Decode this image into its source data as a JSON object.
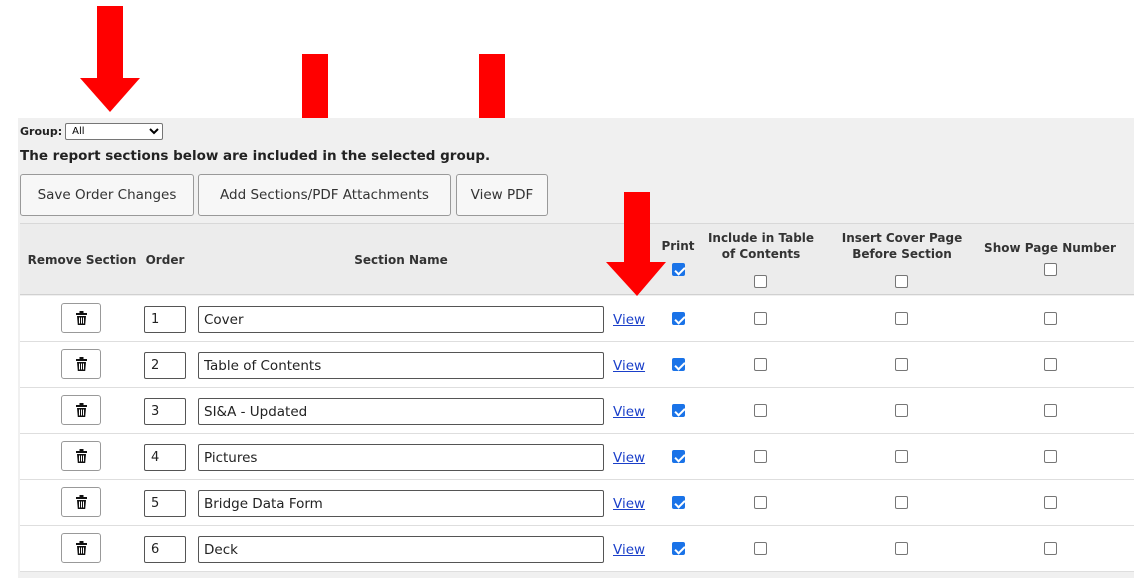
{
  "group": {
    "label": "Group:",
    "selected": "All"
  },
  "report_note": "The report sections below are included in the selected group.",
  "toolbar": {
    "save_label": "Save Order Changes",
    "add_label": "Add Sections/PDF Attachments",
    "view_pdf_label": "View PDF"
  },
  "headers": {
    "remove": "Remove Section",
    "order": "Order",
    "name": "Section Name",
    "print": "Print",
    "toc_line1": "Include in Table",
    "toc_line2": "of Contents",
    "cover_line1": "Insert Cover Page",
    "cover_line2": "Before Section",
    "page_number": "Show Page Number"
  },
  "header_checks": {
    "print": true,
    "toc": false,
    "cover": false,
    "page_number": false
  },
  "rows": [
    {
      "order": "1",
      "name": "Cover",
      "view": "View",
      "print": true,
      "toc": false,
      "cover": false,
      "page_number": false
    },
    {
      "order": "2",
      "name": "Table of Contents",
      "view": "View",
      "print": true,
      "toc": false,
      "cover": false,
      "page_number": false
    },
    {
      "order": "3",
      "name": "SI&A - Updated",
      "view": "View",
      "print": true,
      "toc": false,
      "cover": false,
      "page_number": false
    },
    {
      "order": "4",
      "name": "Pictures",
      "view": "View",
      "print": true,
      "toc": false,
      "cover": false,
      "page_number": false
    },
    {
      "order": "5",
      "name": "Bridge Data Form",
      "view": "View",
      "print": true,
      "toc": false,
      "cover": false,
      "page_number": false
    },
    {
      "order": "6",
      "name": "Deck",
      "view": "View",
      "print": true,
      "toc": false,
      "cover": false,
      "page_number": false
    }
  ],
  "icons": {
    "remove": "trash-icon",
    "annotation": "red-arrow-down-icon"
  },
  "colors": {
    "arrow": "#ff0000",
    "link": "#1a3fc9",
    "checked": "#1a73e8",
    "panel": "#f0f0f0"
  }
}
